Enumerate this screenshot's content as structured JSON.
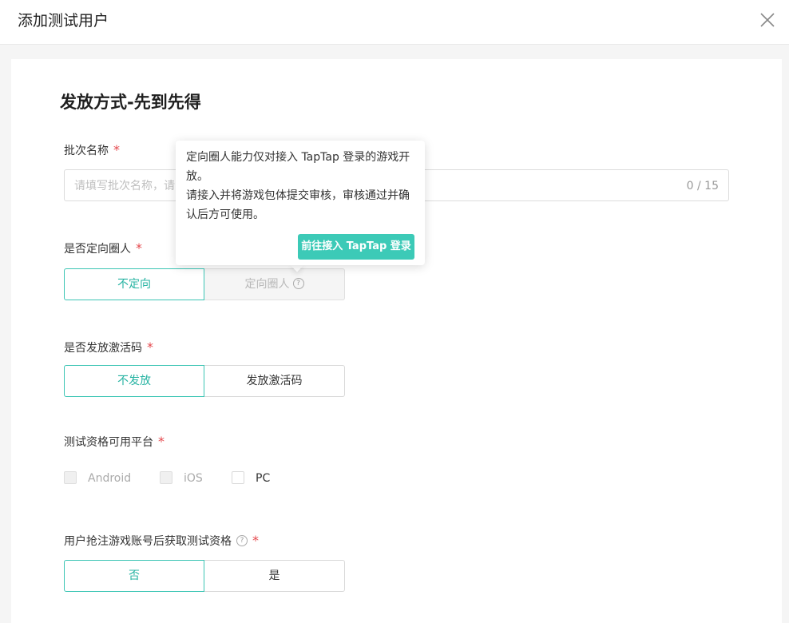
{
  "dialog": {
    "title": "添加测试用户"
  },
  "form": {
    "section_title": "发放方式-先到先得",
    "required_mark": "*",
    "batch_name": {
      "label": "批次名称",
      "placeholder": "请填写批次名称，请",
      "counter": "0 / 15"
    },
    "targeted_circle": {
      "label": "是否定向圈人",
      "options": [
        "不定向",
        "定向圈人"
      ],
      "selected": "不定向"
    },
    "activation_code": {
      "label": "是否发放激活码",
      "options": [
        "不发放",
        "发放激活码"
      ],
      "selected": "不发放"
    },
    "platform": {
      "label": "测试资格可用平台",
      "options": [
        "Android",
        "iOS",
        "PC"
      ]
    },
    "preregister": {
      "label": "用户抢注游戏账号后获取测试资格",
      "options": [
        "否",
        "是"
      ],
      "selected": "否"
    }
  },
  "tooltip": {
    "line1": "定向圈人能力仅对接入 TapTap 登录的游戏开放。",
    "line2": "请接入并将游戏包体提交审核，审核通过并确认后方可使用。",
    "button": "前往接入 TapTap 登录"
  },
  "colors": {
    "accent": "#3cc5b4",
    "required": "#e5484d"
  },
  "icons": {
    "close": "close-icon",
    "help": "question-circle-icon"
  }
}
